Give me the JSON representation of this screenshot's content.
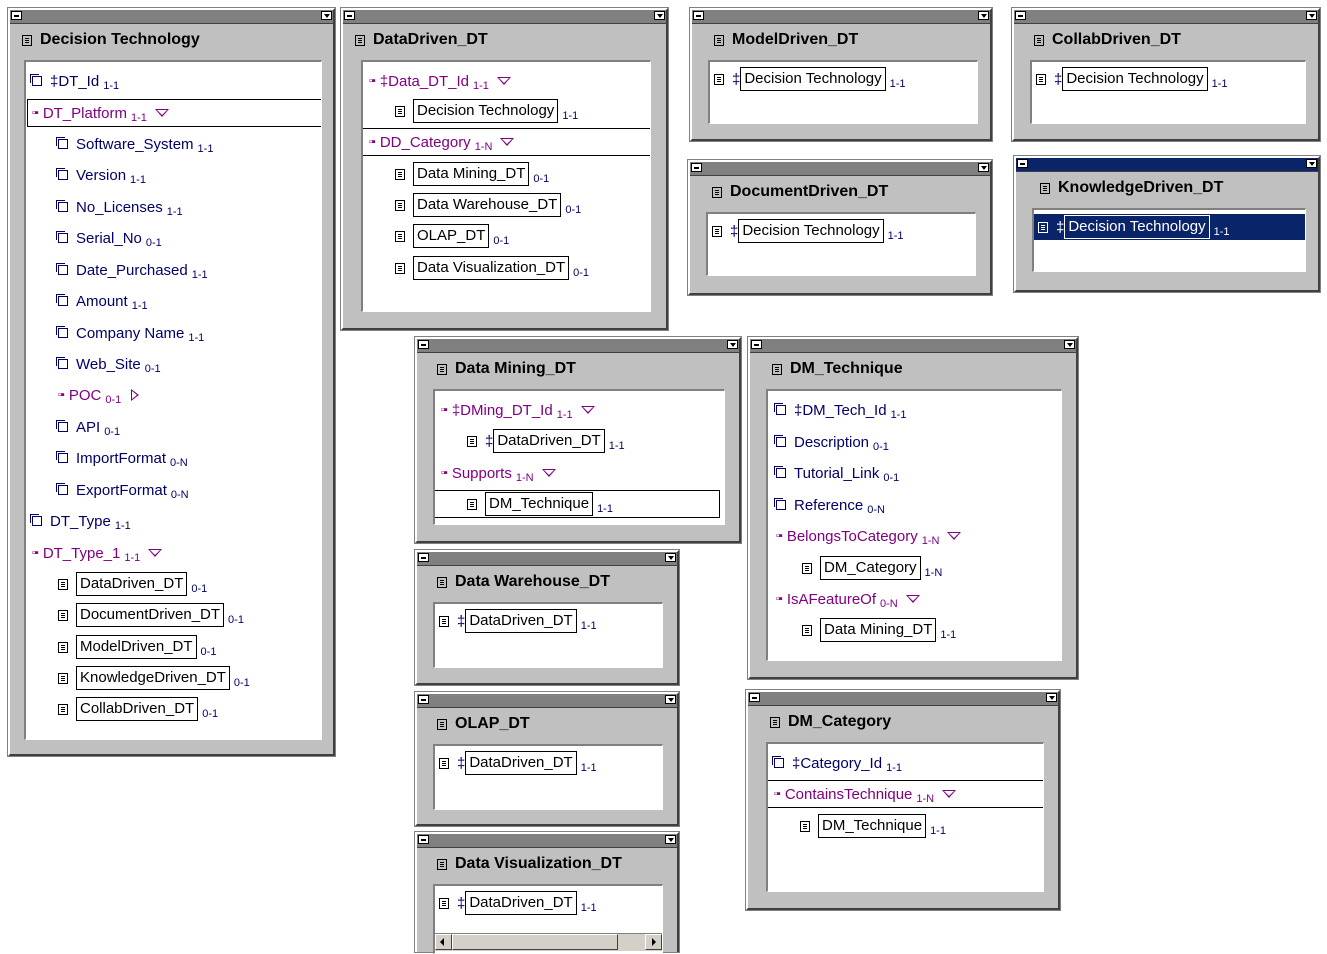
{
  "glyphs": {
    "key": "‡"
  },
  "decision_technology": {
    "title": "Decision Technology",
    "rows": [
      {
        "label": "‡DT_Id",
        "card": "1-1"
      },
      {
        "label": "DT_Platform",
        "card": "1-1"
      },
      {
        "label": "Software_System",
        "card": "1-1"
      },
      {
        "label": "Version",
        "card": "1-1"
      },
      {
        "label": "No_Licenses",
        "card": "1-1"
      },
      {
        "label": "Serial_No",
        "card": "0-1"
      },
      {
        "label": "Date_Purchased",
        "card": "1-1"
      },
      {
        "label": "Amount",
        "card": "1-1"
      },
      {
        "label": "Company Name",
        "card": "1-1"
      },
      {
        "label": "Web_Site",
        "card": "0-1"
      },
      {
        "label": "POC",
        "card": "0-1"
      },
      {
        "label": "API",
        "card": "0-1"
      },
      {
        "label": "ImportFormat",
        "card": "0-N"
      },
      {
        "label": "ExportFormat",
        "card": "0-N"
      },
      {
        "label": "DT_Type",
        "card": "1-1"
      },
      {
        "label": "DT_Type_1",
        "card": "1-1"
      },
      {
        "label": "DataDriven_DT",
        "card": "0-1"
      },
      {
        "label": "DocumentDriven_DT",
        "card": "0-1"
      },
      {
        "label": "ModelDriven_DT",
        "card": "0-1"
      },
      {
        "label": "KnowledgeDriven_DT",
        "card": "0-1"
      },
      {
        "label": "CollabDriven_DT",
        "card": "0-1"
      }
    ]
  },
  "datadriven": {
    "title": "DataDriven_DT",
    "rows": [
      {
        "label": "‡Data_DT_Id",
        "card": "1-1"
      },
      {
        "label": "Decision Technology",
        "card": "1-1"
      },
      {
        "label": "DD_Category",
        "card": "1-N"
      },
      {
        "label": "Data Mining_DT",
        "card": "0-1"
      },
      {
        "label": "Data Warehouse_DT",
        "card": "0-1"
      },
      {
        "label": "OLAP_DT",
        "card": "0-1"
      },
      {
        "label": "Data Visualization_DT",
        "card": "0-1"
      }
    ]
  },
  "modeldriven": {
    "title": "ModelDriven_DT",
    "rows": [
      {
        "label": "Decision Technology",
        "card": "1-1"
      }
    ]
  },
  "collabdriven": {
    "title": "CollabDriven_DT",
    "rows": [
      {
        "label": "Decision Technology",
        "card": "1-1"
      }
    ]
  },
  "documentdriven": {
    "title": "DocumentDriven_DT",
    "rows": [
      {
        "label": "Decision Technology",
        "card": "1-1"
      }
    ]
  },
  "knowledgedriven": {
    "title": "KnowledgeDriven_DT",
    "rows": [
      {
        "label": "Decision Technology",
        "card": "1-1"
      }
    ]
  },
  "datamining": {
    "title": "Data Mining_DT",
    "rows": [
      {
        "label": "‡DMing_DT_Id",
        "card": "1-1"
      },
      {
        "label": "DataDriven_DT",
        "card": "1-1"
      },
      {
        "label": "Supports",
        "card": "1-N"
      },
      {
        "label": "DM_Technique",
        "card": "1-1"
      }
    ]
  },
  "dmtechnique": {
    "title": "DM_Technique",
    "rows": [
      {
        "label": "‡DM_Tech_Id",
        "card": "1-1"
      },
      {
        "label": "Description",
        "card": "0-1"
      },
      {
        "label": "Tutorial_Link",
        "card": "0-1"
      },
      {
        "label": "Reference",
        "card": "0-N"
      },
      {
        "label": "BelongsToCategory",
        "card": "1-N"
      },
      {
        "label": "DM_Category",
        "card": "1-N"
      },
      {
        "label": "IsAFeatureOf",
        "card": "0-N"
      },
      {
        "label": "Data Mining_DT",
        "card": "1-1"
      }
    ]
  },
  "datawarehouse": {
    "title": "Data Warehouse_DT",
    "rows": [
      {
        "label": "DataDriven_DT",
        "card": "1-1"
      }
    ]
  },
  "olap": {
    "title": "OLAP_DT",
    "rows": [
      {
        "label": "DataDriven_DT",
        "card": "1-1"
      }
    ]
  },
  "dmcategory": {
    "title": "DM_Category",
    "rows": [
      {
        "label": "‡Category_Id",
        "card": "1-1"
      },
      {
        "label": "ContainsTechnique",
        "card": "1-N"
      },
      {
        "label": "DM_Technique",
        "card": "1-1"
      }
    ]
  },
  "datavisualization": {
    "title": "Data Visualization_DT",
    "rows": [
      {
        "label": "DataDriven_DT",
        "card": "1-1"
      }
    ]
  }
}
